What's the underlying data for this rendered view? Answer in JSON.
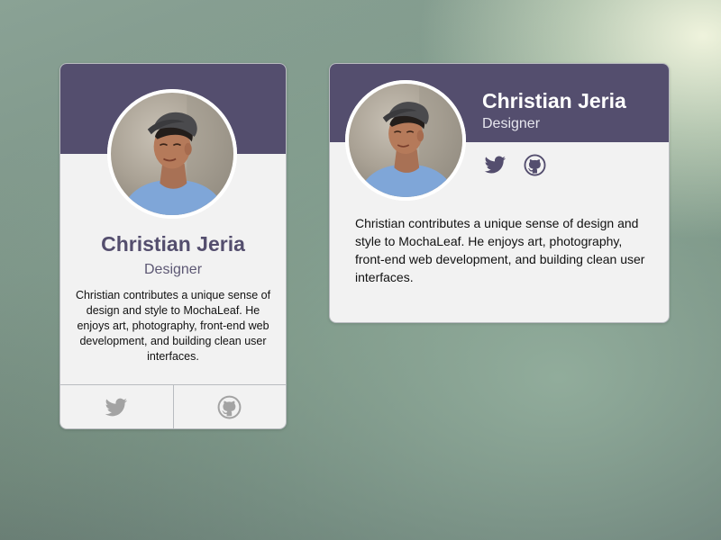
{
  "colors": {
    "banner": "#544e6e",
    "accent_text": "#544e6e",
    "card_bg": "#f2f2f2",
    "icon_muted": "#a3a3a3",
    "icon_dark": "#544e6e"
  },
  "vertical_card": {
    "name": "Christian Jeria",
    "role": "Designer",
    "bio": "Christian contributes a unique sense of design and style to MochaLeaf. He enjoys art, photography, front-end web development, and building clean user interfaces.",
    "footer_icons": [
      "twitter-icon",
      "github-icon"
    ]
  },
  "horizontal_card": {
    "name": "Christian Jeria",
    "role": "Designer",
    "bio": "Christian contributes a unique sense of design and style to MochaLeaf. He enjoys art, photography, front-end web development, and building clean user interfaces.",
    "social_icons": [
      "twitter-icon",
      "github-icon"
    ]
  }
}
